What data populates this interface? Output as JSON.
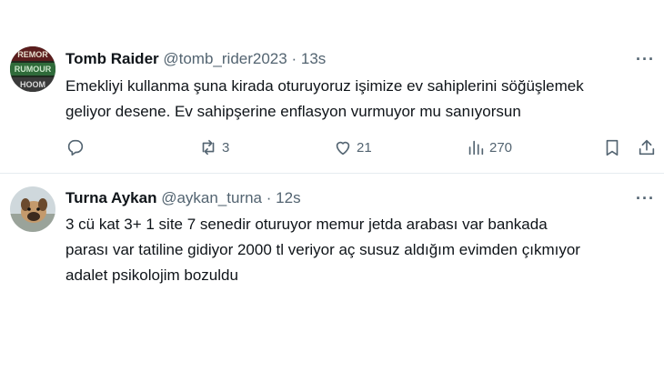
{
  "tweets": [
    {
      "display_name": "Tomb Raider",
      "handle": "@tomb_rider2023",
      "separator": "·",
      "time": "13s",
      "more": "···",
      "text": "Emekliyi kullanma şuna kirada oturuyoruz işimize ev sahiplerini söğüşlemek\ngeliyor desene. Ev sahipşerine enflasyon vurmuyor mu sanıyorsun",
      "reply_icon": "reply-icon",
      "retweets": "3",
      "likes": "21",
      "views": "270",
      "avatar_text": "REMOR RUMOUR HOOM"
    },
    {
      "display_name": "Turna Aykan",
      "handle": "@aykan_turna",
      "separator": "·",
      "time": "12s",
      "more": "···",
      "text": "3 cü kat 3+ 1 site 7 senedir oturuyor memur jetda arabası var bankada\nparası var tatiline gidiyor 2000 tl veriyor aç susuz aldığım evimden çıkmıyor\nadalet psikolojim bozuldu"
    }
  ],
  "colors": {
    "text": "#0f1419",
    "secondary": "#536471",
    "divider": "#e6ecf0"
  }
}
